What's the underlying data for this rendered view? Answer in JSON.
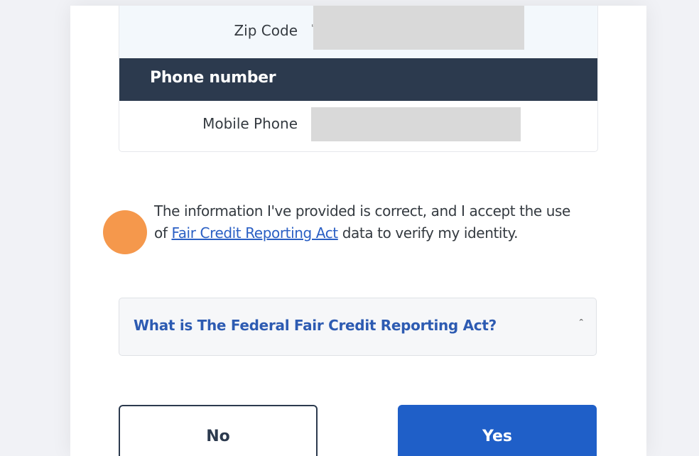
{
  "form": {
    "zip_label": "Zip Code",
    "zip_value": "",
    "phone_section_title": "Phone number",
    "mobile_label": "Mobile Phone",
    "mobile_value": ""
  },
  "consent": {
    "text_before": "The information I've provided is correct, and I accept the use of ",
    "link_text": "Fair Credit Reporting Act",
    "text_after": " data to verify my identity."
  },
  "faq": {
    "title": "What is The Federal Fair Credit Reporting Act?",
    "caret_icon": "chevron-up-icon"
  },
  "buttons": {
    "no_label": "No",
    "yes_label": "Yes"
  },
  "colors": {
    "header_bg": "#2c3a4e",
    "accent_blue": "#1f5fc8",
    "consent_marker": "#f5984c"
  }
}
